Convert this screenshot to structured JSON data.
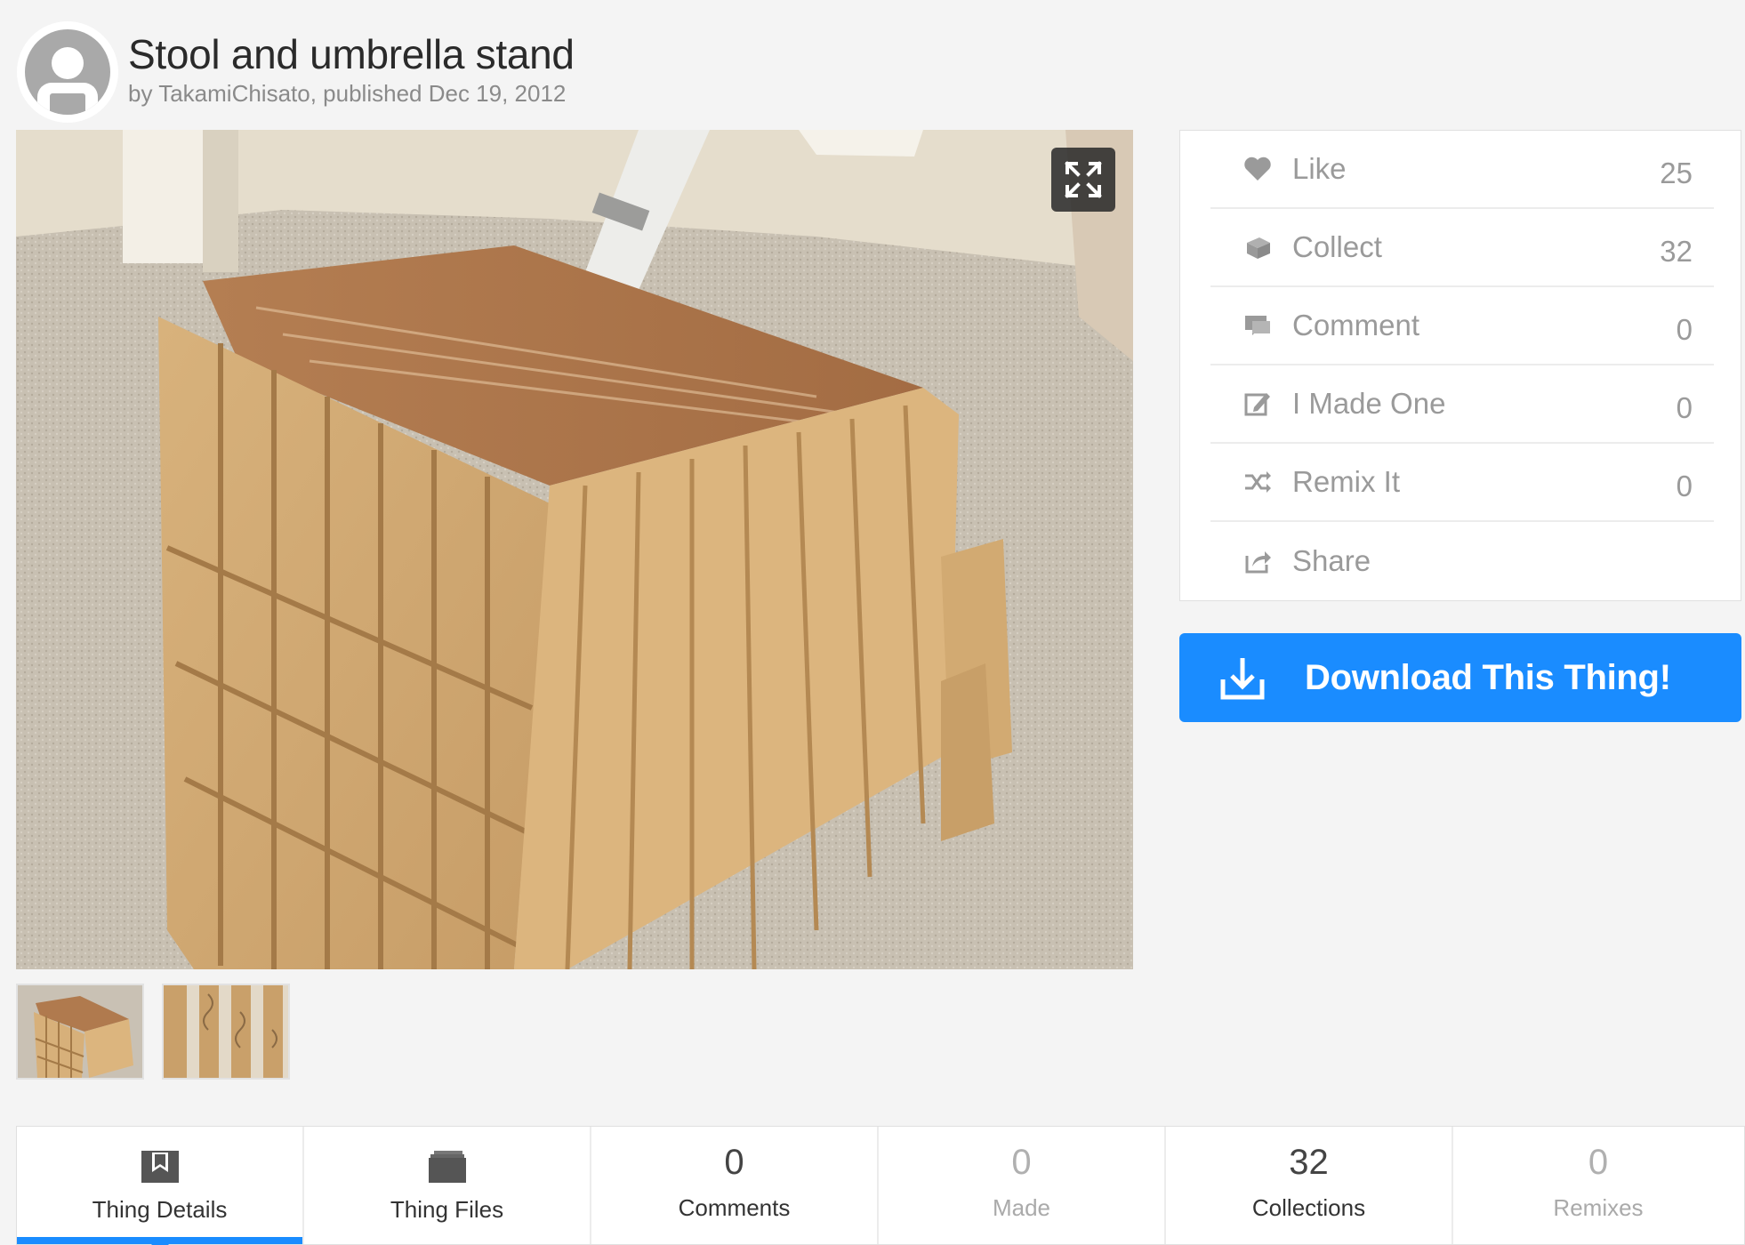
{
  "header": {
    "title": "Stool and umbrella stand",
    "byline": "by TakamiChisato, published Dec 19, 2012"
  },
  "stats": [
    {
      "icon": "heart-icon",
      "label": "Like",
      "value": "25"
    },
    {
      "icon": "collect-icon",
      "label": "Collect",
      "value": "32"
    },
    {
      "icon": "comment-icon",
      "label": "Comment",
      "value": "0"
    },
    {
      "icon": "made-one-icon",
      "label": "I Made One",
      "value": "0"
    },
    {
      "icon": "remix-icon",
      "label": "Remix It",
      "value": "0"
    },
    {
      "icon": "share-icon",
      "label": "Share",
      "value": ""
    }
  ],
  "download": {
    "label": "Download This Thing!"
  },
  "tabs": [
    {
      "label": "Thing Details",
      "count": "",
      "active": true
    },
    {
      "label": "Thing Files",
      "count": ""
    },
    {
      "label": "Comments",
      "count": "0"
    },
    {
      "label": "Made",
      "count": "0"
    },
    {
      "label": "Collections",
      "count": "32"
    },
    {
      "label": "Remixes",
      "count": "0"
    }
  ],
  "colors": {
    "accent": "#1a8cff",
    "background": "#f4f4f4",
    "muted_text": "#9a9a9a"
  }
}
